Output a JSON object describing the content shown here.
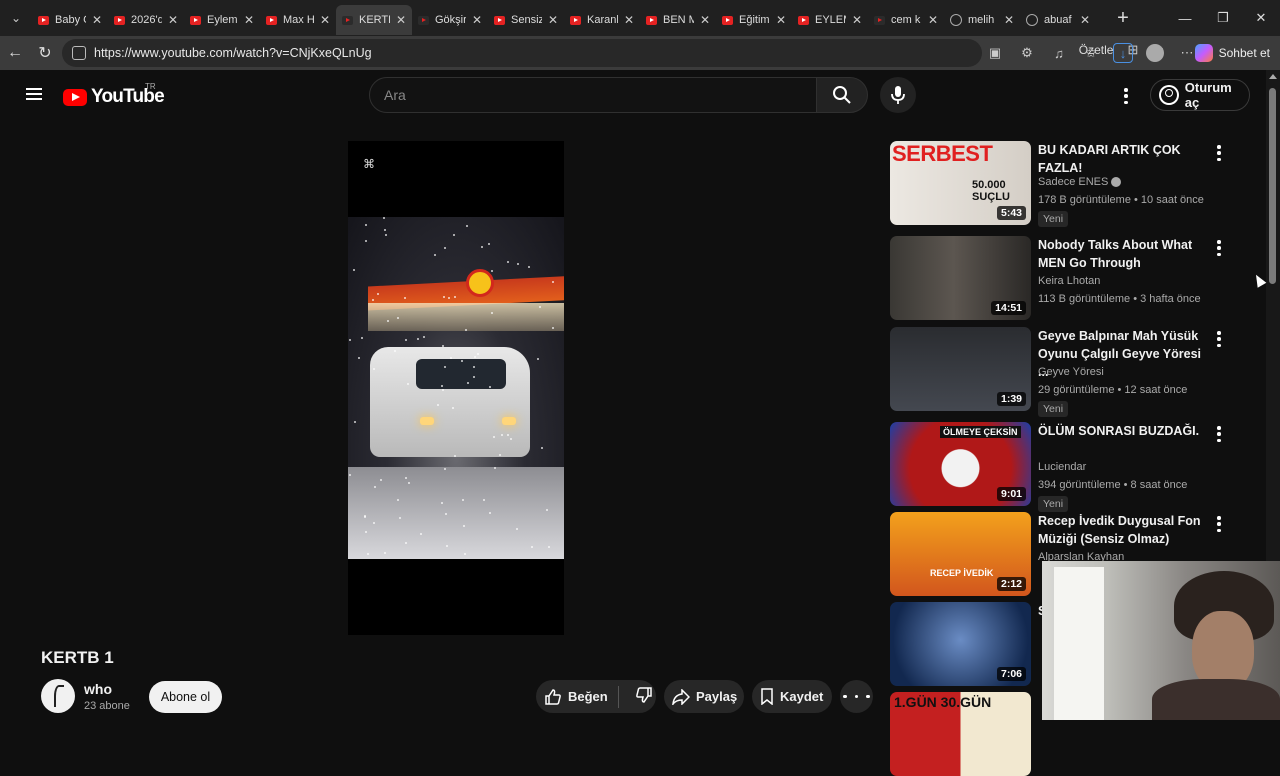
{
  "browser": {
    "tabs": [
      {
        "title": "Baby C",
        "favicon": "youtube-icon"
      },
      {
        "title": "2026'd",
        "favicon": "youtube-icon"
      },
      {
        "title": "Eylem",
        "favicon": "youtube-icon"
      },
      {
        "title": "Max H",
        "favicon": "youtube-icon"
      },
      {
        "title": "KERTB",
        "favicon": "youtube-icon",
        "active": true
      },
      {
        "title": "Gökşir",
        "favicon": "youtube-icon"
      },
      {
        "title": "Sensiz",
        "favicon": "youtube-icon"
      },
      {
        "title": "Karanl",
        "favicon": "youtube-icon"
      },
      {
        "title": "BEN M",
        "favicon": "youtube-icon"
      },
      {
        "title": "Eğitim",
        "favicon": "youtube-icon"
      },
      {
        "title": "EYLEM",
        "favicon": "youtube-icon"
      },
      {
        "title": "cem k",
        "favicon": "youtube-icon"
      },
      {
        "title": "melih",
        "favicon": "globe-icon"
      },
      {
        "title": "abuaf",
        "favicon": "globe-icon"
      }
    ],
    "url": "https://www.youtube.com/watch?v=CNjKxeQLnUg",
    "read_mode_label": "Özetle",
    "copilot_label": "Sohbet et"
  },
  "youtube": {
    "logo_text": "YouTube",
    "region": "TR",
    "search_placeholder": "Ara",
    "signin_label": "Oturum aç"
  },
  "video": {
    "title": "KERTB 1",
    "channel": "who",
    "subscribers": "23 abone",
    "subscribe_label": "Abone ol",
    "like_label": "Beğen",
    "share_label": "Paylaş",
    "save_label": "Kaydet"
  },
  "recommendations": [
    {
      "title": "BU KADARI ARTIK ÇOK FAZLA!",
      "channel": "Sadece ENES",
      "verified": true,
      "views": "178 B görüntüleme",
      "age": "10 saat önce",
      "badge": "Yeni",
      "duration": "5:43",
      "thumb_text": "SERBEST",
      "thumb_sub": "50.000 SUÇLU"
    },
    {
      "title": "Nobody Talks About What MEN Go Through",
      "channel": "Keira Lhotan",
      "views": "113 B görüntüleme",
      "age": "3 hafta önce",
      "duration": "14:51"
    },
    {
      "title": "Geyve Balpınar Mah Yüsük Oyunu Çalgılı Geyve Yöresi ...",
      "channel": "Geyve Yöresi",
      "views": "29 görüntüleme",
      "age": "12 saat önce",
      "badge": "Yeni",
      "duration": "1:39"
    },
    {
      "title": "ÖLÜM SONRASI BUZDAĞI.",
      "channel": "Luciendar",
      "views": "394 görüntüleme",
      "age": "8 saat önce",
      "badge": "Yeni",
      "duration": "9:01",
      "thumb_text": "ÖLMEYE ÇEKSİN"
    },
    {
      "title": "Recep İvedik Duygusal Fon Müziği (Sensiz Olmaz)",
      "channel": "Alparslan Kayhan",
      "duration": "2:12",
      "thumb_text": "RECEP İVEDİK"
    },
    {
      "title": "S",
      "duration": "7:06"
    },
    {
      "thumb_text": "1.GÜN 30.GÜN"
    }
  ]
}
